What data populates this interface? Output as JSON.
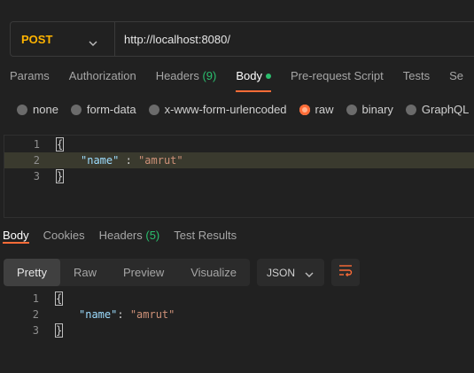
{
  "request": {
    "method": "POST",
    "url": "http://localhost:8080/"
  },
  "request_tabs": [
    {
      "label": "Params"
    },
    {
      "label": "Authorization"
    },
    {
      "label": "Headers",
      "count": "(9)"
    },
    {
      "label": "Body"
    },
    {
      "label": "Pre-request Script"
    },
    {
      "label": "Tests"
    },
    {
      "label": "Se"
    }
  ],
  "body_types": {
    "none": "none",
    "form_data": "form-data",
    "urlencoded": "x-www-form-urlencoded",
    "raw": "raw",
    "binary": "binary",
    "graphql": "GraphQL"
  },
  "request_body": {
    "line_numbers": [
      "1",
      "2",
      "3"
    ],
    "open_brace": "{",
    "key": "\"name\"",
    "sep": " : ",
    "value": "\"amrut\"",
    "close_brace": "}"
  },
  "response_tabs": [
    {
      "label": "Body"
    },
    {
      "label": "Cookies"
    },
    {
      "label": "Headers",
      "count": "(5)"
    },
    {
      "label": "Test Results"
    }
  ],
  "response_toolbar": {
    "views": [
      "Pretty",
      "Raw",
      "Preview",
      "Visualize"
    ],
    "format": "JSON"
  },
  "response_body": {
    "line_numbers": [
      "1",
      "2",
      "3"
    ],
    "open_brace": "{",
    "key": "\"name\"",
    "sep": ": ",
    "value": "\"amrut\"",
    "close_brace": "}"
  },
  "colors": {
    "accent": "#ff6c37",
    "method": "#ffb400",
    "count_green": "#2bbf6e"
  }
}
